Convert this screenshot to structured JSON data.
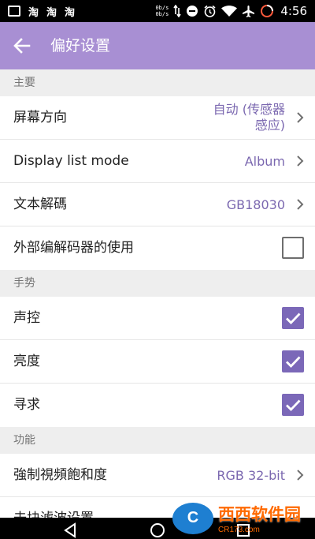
{
  "status_bar": {
    "left_icons": [
      "淘",
      "淘",
      "淘"
    ],
    "net_up": "0b/s",
    "net_down": "0b/s",
    "time": "4:56"
  },
  "app_bar": {
    "title": "偏好设置",
    "back_icon": "arrow-left-icon"
  },
  "sections": [
    {
      "header": "主要",
      "items": [
        {
          "label": "屏幕方向",
          "value": "自动 (传感器感应)",
          "type": "value"
        },
        {
          "label": "Display list mode",
          "value": "Album",
          "type": "value"
        },
        {
          "label": "文本解碼",
          "value": "GB18030",
          "type": "value"
        },
        {
          "label": "外部编解码器的使用",
          "checked": false,
          "type": "checkbox"
        }
      ]
    },
    {
      "header": "手势",
      "items": [
        {
          "label": "声控",
          "checked": true,
          "type": "checkbox"
        },
        {
          "label": "亮度",
          "checked": true,
          "type": "checkbox"
        },
        {
          "label": "寻求",
          "checked": true,
          "type": "checkbox"
        }
      ]
    },
    {
      "header": "功能",
      "items": [
        {
          "label": "強制視頻飽和度",
          "value": "RGB 32-bit",
          "type": "value"
        },
        {
          "label": "去块滤波设置",
          "value": "",
          "type": "value"
        }
      ]
    }
  ],
  "watermark": {
    "logo": "C",
    "text": "西西软件园",
    "sub": "CR173.com"
  },
  "colors": {
    "accent": "#a88fd3",
    "value_text": "#7b68b0",
    "checkbox_on": "#7b68b8"
  }
}
